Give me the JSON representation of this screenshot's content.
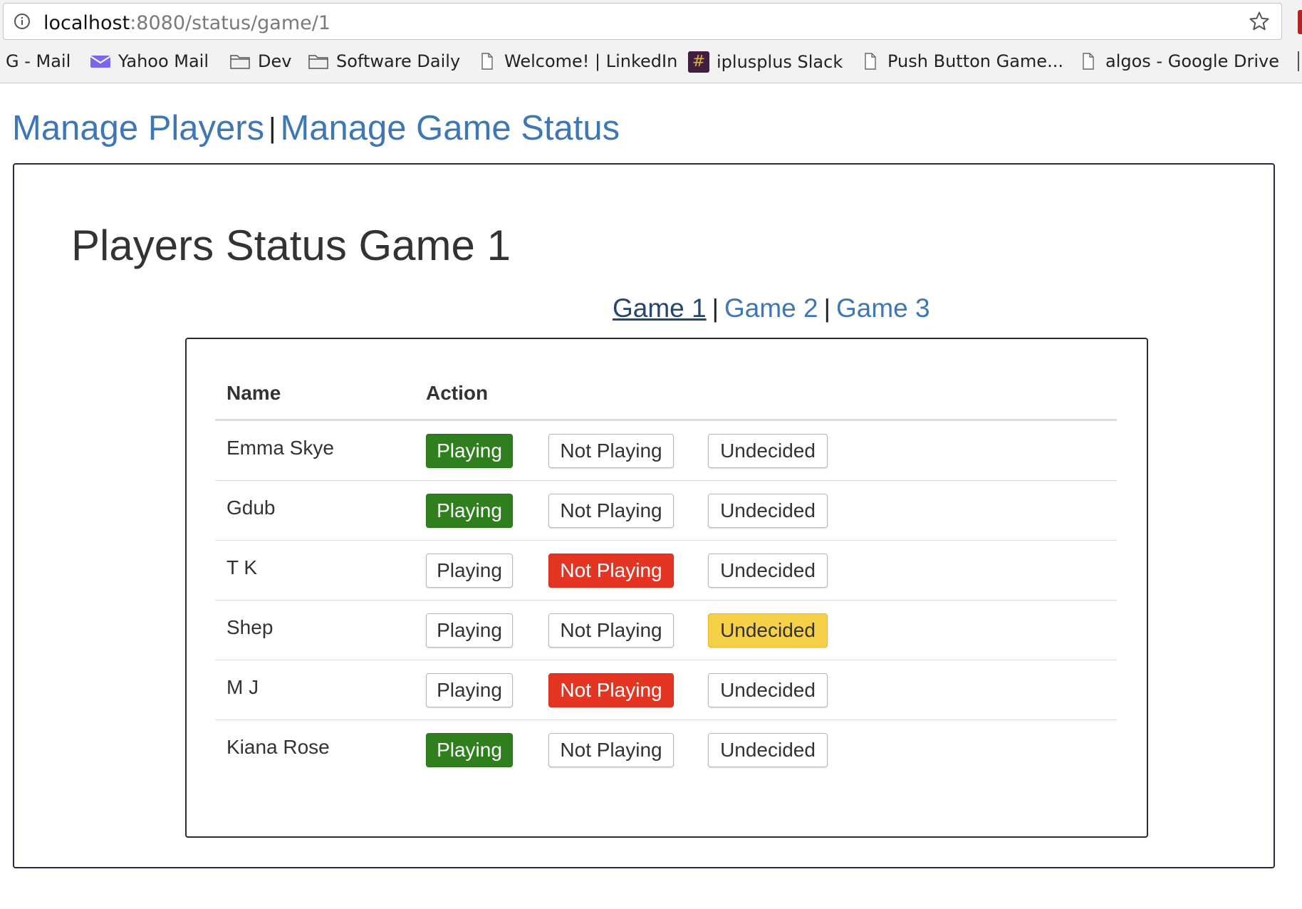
{
  "browser": {
    "url_host": "localhost",
    "url_path": ":8080/status/game/1",
    "bookmarks": [
      {
        "label": "G - Mail",
        "icon": "none"
      },
      {
        "label": "Yahoo Mail",
        "icon": "envelope-icon"
      },
      {
        "label": "Dev",
        "icon": "folder-icon"
      },
      {
        "label": "Software Daily",
        "icon": "folder-icon"
      },
      {
        "label": "Welcome! | LinkedIn",
        "icon": "page-icon"
      },
      {
        "label": "iplusplus Slack",
        "icon": "hash-icon"
      },
      {
        "label": "Push Button Game...",
        "icon": "page-icon"
      },
      {
        "label": "algos - Google Drive",
        "icon": "page-icon"
      }
    ],
    "slack_glyph": "#"
  },
  "nav": {
    "manage_players": "Manage Players",
    "separator": "|",
    "manage_game_status": "Manage Game Status"
  },
  "page": {
    "title": "Players Status Game 1"
  },
  "game_tabs": {
    "items": [
      "Game 1",
      "Game 2",
      "Game 3"
    ],
    "active": "Game 1",
    "separator": "|"
  },
  "table": {
    "headers": {
      "name": "Name",
      "action": "Action"
    },
    "button_labels": {
      "playing": "Playing",
      "not_playing": "Not Playing",
      "undecided": "Undecided"
    },
    "rows": [
      {
        "name": "Emma Skye",
        "status": "playing"
      },
      {
        "name": "Gdub",
        "status": "playing"
      },
      {
        "name": "T K",
        "status": "not_playing"
      },
      {
        "name": "Shep",
        "status": "undecided"
      },
      {
        "name": "M J",
        "status": "not_playing"
      },
      {
        "name": "Kiana Rose",
        "status": "playing"
      }
    ]
  },
  "colors": {
    "link": "#3d78b5",
    "active_link": "#24476f",
    "playing": "#2f7f1f",
    "not_playing": "#e43522",
    "undecided": "#f6d046"
  }
}
